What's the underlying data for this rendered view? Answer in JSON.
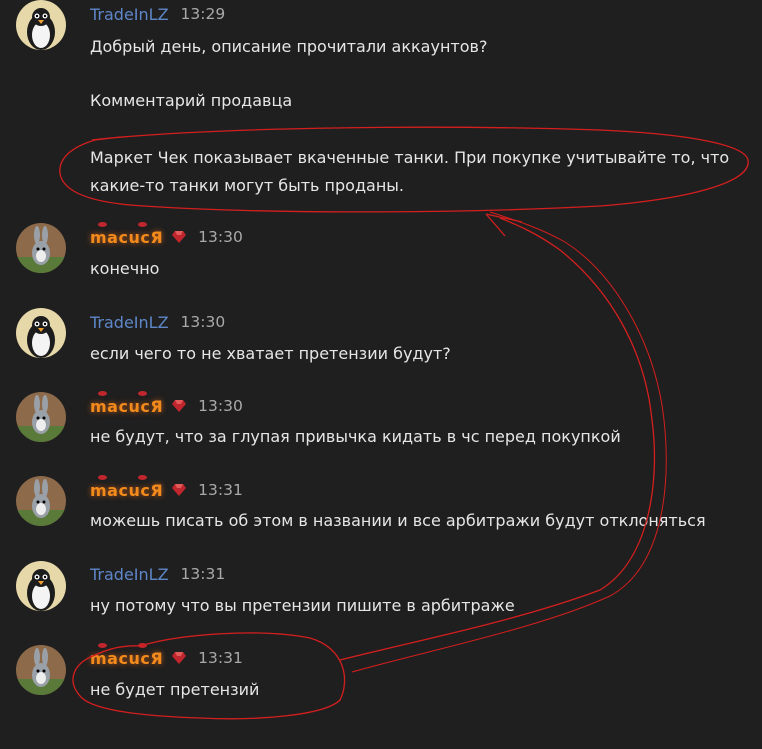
{
  "users": {
    "trade": {
      "name": "TradeInLZ",
      "avatar_icon": "penguin-avatar-icon"
    },
    "macuc": {
      "name": "macucЯ",
      "avatar_icon": "bunny-avatar-icon",
      "badge_icon": "red-gem-icon"
    }
  },
  "messages": [
    {
      "user": "TradeInLZ",
      "time": "13:29",
      "lines": [
        "Добрый день, описание прочитали аккаунтов?",
        "Комментарий продавца",
        "Маркет Чек показывает вкаченные танки. При покупке учитывайте то, что",
        "какие-то танки могут быть проданы."
      ]
    },
    {
      "user": "macucЯ",
      "time": "13:30",
      "lines": [
        "конечно"
      ]
    },
    {
      "user": "TradeInLZ",
      "time": "13:30",
      "lines": [
        "если чего то не хватает претензии будут?"
      ]
    },
    {
      "user": "macucЯ",
      "time": "13:30",
      "lines": [
        "не будут, что за глупая привычка кидать в чс перед покупкой"
      ]
    },
    {
      "user": "macucЯ",
      "time": "13:31",
      "lines": [
        "можешь писать об этом в названии и все арбитражи будут отклоняться"
      ]
    },
    {
      "user": "TradeInLZ",
      "time": "13:31",
      "lines": [
        "ну потому что вы претензии пишите в арбитраже"
      ]
    },
    {
      "user": "macucЯ",
      "time": "13:31",
      "lines": [
        "не будет претензий"
      ]
    }
  ],
  "colors": {
    "background": "#1f1f1f",
    "trade_name": "#5e87c9",
    "macuc_name": "#f28a1c",
    "annotation": "#d41f1f",
    "timestamp": "#a9a9a9"
  }
}
